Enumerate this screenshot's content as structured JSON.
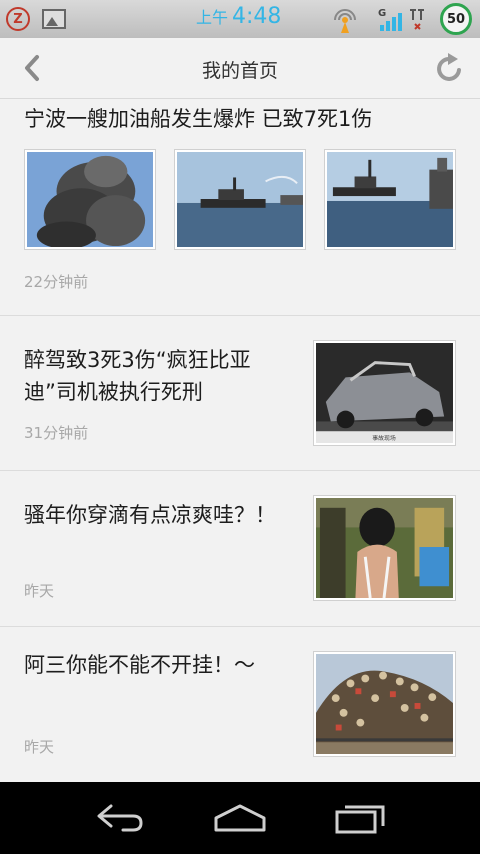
{
  "status_bar": {
    "ampm": "上午",
    "time": "4:48",
    "network": "G",
    "battery": "50",
    "notif_letter": "Z",
    "icons": [
      "notification-z-icon",
      "gallery-icon",
      "antenna-icon",
      "signal-icon",
      "wifi-icon",
      "battery-icon"
    ],
    "colors": {
      "time": "#33b5e5",
      "battery_ring": "#2ea44f",
      "notif": "#c0392b"
    }
  },
  "header": {
    "title": "我的首页",
    "icons": [
      "back-icon",
      "refresh-icon"
    ]
  },
  "articles": [
    {
      "headline": "宁波一艘加油船发生爆炸 已致7死1伤",
      "time": "22分钟前",
      "images": [
        "smoke-photo",
        "tugboat-photo",
        "ship-photo"
      ]
    },
    {
      "headline": "醉驾致3死3伤“疯狂比亚迪”司机被执行死刑",
      "time": "31分钟前",
      "images": [
        "wrecked-car-photo"
      ],
      "caption": "事故现场"
    },
    {
      "headline": "骚年你穿滴有点凉爽哇？！",
      "time": "昨天",
      "images": [
        "crowded-bus-photo"
      ]
    },
    {
      "headline": "阿三你能不能不开挂！～",
      "time": "昨天",
      "images": [
        "overloaded-train-photo"
      ]
    }
  ],
  "nav_bar": {
    "icons": [
      "back-nav-icon",
      "home-nav-icon",
      "recent-apps-icon"
    ]
  }
}
